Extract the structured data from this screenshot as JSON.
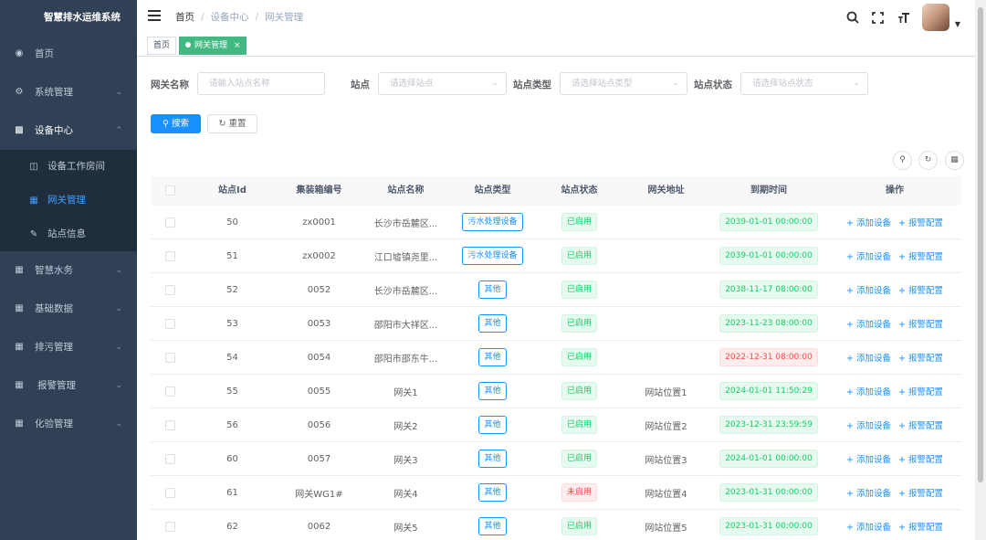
{
  "app": {
    "title": "智慧排水运维系统"
  },
  "sidebar": {
    "items": [
      {
        "label": "首页",
        "icon": "dashboard-icon"
      },
      {
        "label": "系统管理",
        "icon": "gear-icon"
      },
      {
        "label": "设备中心",
        "icon": "tree-icon"
      },
      {
        "label": "智慧水务",
        "icon": "grid-icon"
      },
      {
        "label": "基础数据",
        "icon": "grid-icon"
      },
      {
        "label": "排污管理",
        "icon": "grid-icon"
      },
      {
        "label": "报警管理",
        "icon": "grid-icon"
      },
      {
        "label": "化验管理",
        "icon": "grid-icon"
      }
    ],
    "sub_items": [
      {
        "label": "设备工作房间",
        "icon": "book-icon"
      },
      {
        "label": "网关管理",
        "icon": "calendar-icon"
      },
      {
        "label": "站点信息",
        "icon": "edit-icon"
      }
    ]
  },
  "breadcrumb": {
    "home": "首页",
    "sep": "/",
    "level1": "设备中心",
    "level2": "网关管理"
  },
  "tags": {
    "home": "首页",
    "current": "网关管理",
    "close": "×"
  },
  "search": {
    "gateway_name_label": "网关名称",
    "gateway_name_placeholder": "请输入站点名称",
    "site_label": "站点",
    "site_placeholder": "请选择站点",
    "site_type_label": "站点类型",
    "site_type_placeholder": "请选择站点类型",
    "site_status_label": "站点状态",
    "site_status_placeholder": "请选择站点状态",
    "search_button": "搜索",
    "reset_button": "重置"
  },
  "table": {
    "headers": [
      "站点Id",
      "集装箱编号",
      "站点名称",
      "站点类型",
      "站点状态",
      "网关地址",
      "到期时间",
      "操作"
    ],
    "op_add": "+ 添加设备",
    "op_alarm": "+ 报警配置",
    "rows": [
      {
        "id": "50",
        "no": "zx0001",
        "name": "长沙市岳麓区...",
        "type": "污水处理设备",
        "status": "已启用",
        "status_ok": true,
        "addr": "",
        "expire": "2039-01-01 00:00:00",
        "expired": false
      },
      {
        "id": "51",
        "no": "zx0002",
        "name": "江口墟镇尧里...",
        "type": "污水处理设备",
        "status": "已启用",
        "status_ok": true,
        "addr": "",
        "expire": "2039-01-01 00:00:00",
        "expired": false
      },
      {
        "id": "52",
        "no": "0052",
        "name": "长沙市岳麓区...",
        "type": "其他",
        "status": "已启用",
        "status_ok": true,
        "addr": "",
        "expire": "2038-11-17 08:00:00",
        "expired": false
      },
      {
        "id": "53",
        "no": "0053",
        "name": "邵阳市大祥区...",
        "type": "其他",
        "status": "已启用",
        "status_ok": true,
        "addr": "",
        "expire": "2023-11-23 08:00:00",
        "expired": false
      },
      {
        "id": "54",
        "no": "0054",
        "name": "邵阳市邵东牛...",
        "type": "其他",
        "status": "已启用",
        "status_ok": true,
        "addr": "",
        "expire": "2022-12-31 08:00:00",
        "expired": true
      },
      {
        "id": "55",
        "no": "0055",
        "name": "网关1",
        "type": "其他",
        "status": "已启用",
        "status_ok": true,
        "addr": "网站位置1",
        "expire": "2024-01-01 11:50:29",
        "expired": false
      },
      {
        "id": "56",
        "no": "0056",
        "name": "网关2",
        "type": "其他",
        "status": "已启用",
        "status_ok": true,
        "addr": "网站位置2",
        "expire": "2023-12-31 23:59:59",
        "expired": false
      },
      {
        "id": "60",
        "no": "0057",
        "name": "网关3",
        "type": "其他",
        "status": "已启用",
        "status_ok": true,
        "addr": "网站位置3",
        "expire": "2024-01-01 00:00:00",
        "expired": false
      },
      {
        "id": "61",
        "no": "网关WG1#",
        "name": "网关4",
        "type": "其他",
        "status": "未启用",
        "status_ok": false,
        "addr": "网站位置4",
        "expire": "2023-01-31 00:00:00",
        "expired": false
      },
      {
        "id": "62",
        "no": "0062",
        "name": "网关5",
        "type": "其他",
        "status": "已启用",
        "status_ok": true,
        "addr": "网站位置5",
        "expire": "2023-01-31 00:00:00",
        "expired": false
      }
    ]
  }
}
